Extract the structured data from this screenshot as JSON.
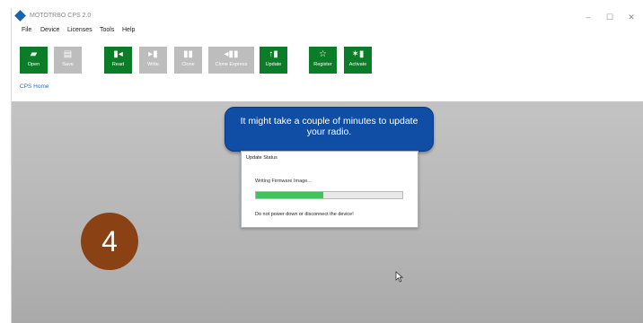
{
  "window": {
    "title": "MOTOTRBO CPS 2.0",
    "controls": {
      "minimize": "–",
      "maximize": "☐",
      "close": "✕"
    }
  },
  "menu": [
    "File",
    "Device",
    "Licenses",
    "Tools",
    "Help"
  ],
  "toolbar": {
    "buttons": [
      {
        "label": "Open",
        "icon": "folder-icon",
        "enabled": true
      },
      {
        "label": "Save",
        "icon": "save-icon",
        "enabled": false
      },
      {
        "label": "Read",
        "icon": "read-icon",
        "enabled": true
      },
      {
        "label": "Write",
        "icon": "write-icon",
        "enabled": false
      },
      {
        "label": "Clone",
        "icon": "clone-icon",
        "enabled": false
      },
      {
        "label": "Clone Express",
        "icon": "clone-express-icon",
        "enabled": false
      },
      {
        "label": "Update",
        "icon": "update-icon",
        "enabled": true
      },
      {
        "label": "Register",
        "icon": "star-icon",
        "enabled": true
      },
      {
        "label": "Activate",
        "icon": "activate-icon",
        "enabled": true
      }
    ],
    "colors": {
      "enabled": "#0b7c27",
      "disabled": "#bdbdbd"
    }
  },
  "breadcrumb": "CPS Home",
  "callout": {
    "line1": "It might take a couple of minutes to update",
    "line2": "your radio."
  },
  "dialog": {
    "title": "Update Status",
    "message": "Writing Firmware Image...",
    "progress_percent": 46,
    "warning": "Do not power down or disconnect the device!"
  },
  "step": {
    "number": "4",
    "color": "#8a4215"
  }
}
